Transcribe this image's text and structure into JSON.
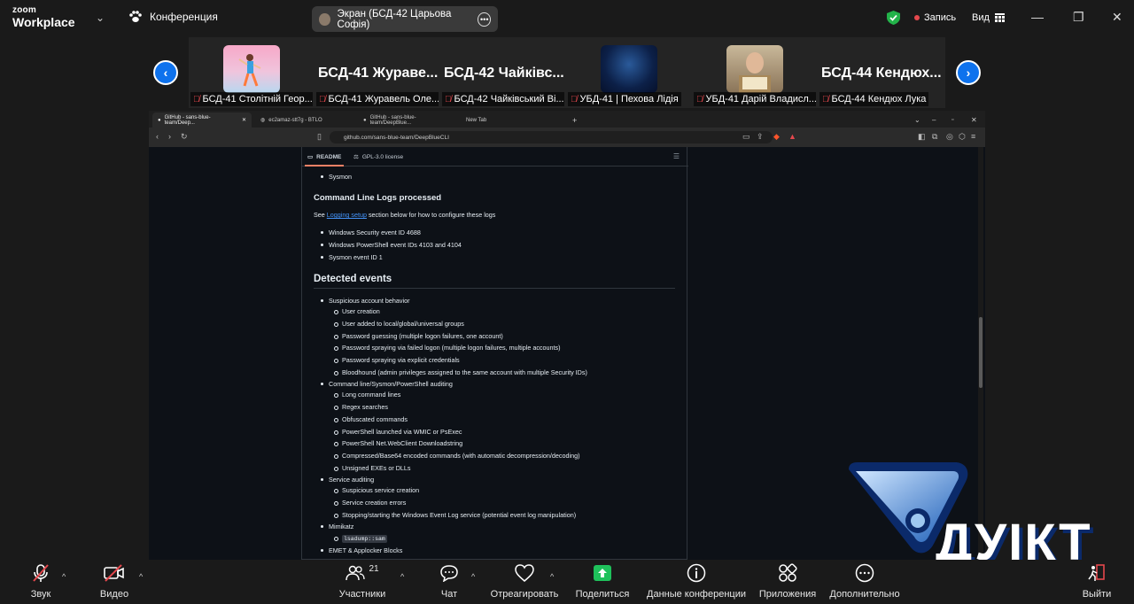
{
  "app": {
    "brand_small": "zoom",
    "brand_large": "Workplace",
    "meeting_label": "Конференция"
  },
  "share_pill": {
    "label": "Экран (БСД-42 Царьова Софія)"
  },
  "top_right": {
    "recording": "Запись",
    "view": "Вид"
  },
  "gallery": {
    "tiles": [
      {
        "label": "БСД-41 Столітній Геор...",
        "big_name": ""
      },
      {
        "label": "БСД-41 Журавель Оле...",
        "big_name": "БСД-41  Жураве..."
      },
      {
        "label": "БСД-42 Чайківський Ві...",
        "big_name": "БСД-42  Чайківс..."
      },
      {
        "label": "УБД-41 | Пехова Лідія",
        "big_name": ""
      },
      {
        "label": "УБД-41 Дарій Владисл...",
        "big_name": ""
      },
      {
        "label": "БСД-44 Кендюх Лука",
        "big_name": "БСД-44  Кендюх..."
      }
    ]
  },
  "browser": {
    "tabs": [
      "GitHub - sans-blue-team/Deep...",
      "ec2amaz-stt7g - BTLO",
      "GitHub - sans-blue-team/DeepBlue...",
      "New Tab"
    ],
    "url": "github.com/sans-blue-team/DeepBlueCLI"
  },
  "readme": {
    "tab_readme": "README",
    "tab_license": "GPL-3.0 license",
    "item_sysmon": "Sysmon",
    "h_cmdline": "Command Line Logs processed",
    "see_prefix": "See ",
    "see_link": "Logging setup",
    "see_suffix": " section below for how to configure these logs",
    "cmd_items": [
      "Windows Security event ID 4688",
      "Windows PowerShell event IDs 4103 and 4104",
      "Sysmon event ID 1"
    ],
    "h_detected": "Detected events",
    "g1": "Suspicious account behavior",
    "g1_items": [
      "User creation",
      "User added to local/global/universal groups",
      "Password guessing (multiple logon failures, one account)",
      "Password spraying via failed logon (multiple logon failures, multiple accounts)",
      "Password spraying via explicit credentials",
      "Bloodhound (admin privileges assigned to the same account with multiple Security IDs)"
    ],
    "g2": "Command line/Sysmon/PowerShell auditing",
    "g2_items": [
      "Long command lines",
      "Regex searches",
      "Obfuscated commands",
      "PowerShell launched via WMIC or PsExec",
      "PowerShell Net.WebClient Downloadstring",
      "Compressed/Base64 encoded commands (with automatic decompression/decoding)",
      "Unsigned EXEs or DLLs"
    ],
    "g3": "Service auditing",
    "g3_items": [
      "Suspicious service creation",
      "Service creation errors",
      "Stopping/starting the Windows Event Log service (potential event log manipulation)"
    ],
    "g4": "Mimikatz",
    "g4_code": "lsadump::sam",
    "g5": "EMET & Applocker Blocks"
  },
  "logo_text": "ДУІКТ",
  "toolbar": {
    "audio": "Звук",
    "video": "Видео",
    "participants": "Участники",
    "participants_count": "21",
    "chat": "Чат",
    "react": "Отреагировать",
    "share": "Поделиться",
    "info": "Данные конференции",
    "apps": "Приложения",
    "more": "Дополнительно",
    "leave": "Выйти"
  },
  "colors": {
    "accent": "#0e72ed",
    "share_green": "#1fc15b",
    "muted_red": "#e5484d",
    "gh_link": "#4493f8"
  }
}
